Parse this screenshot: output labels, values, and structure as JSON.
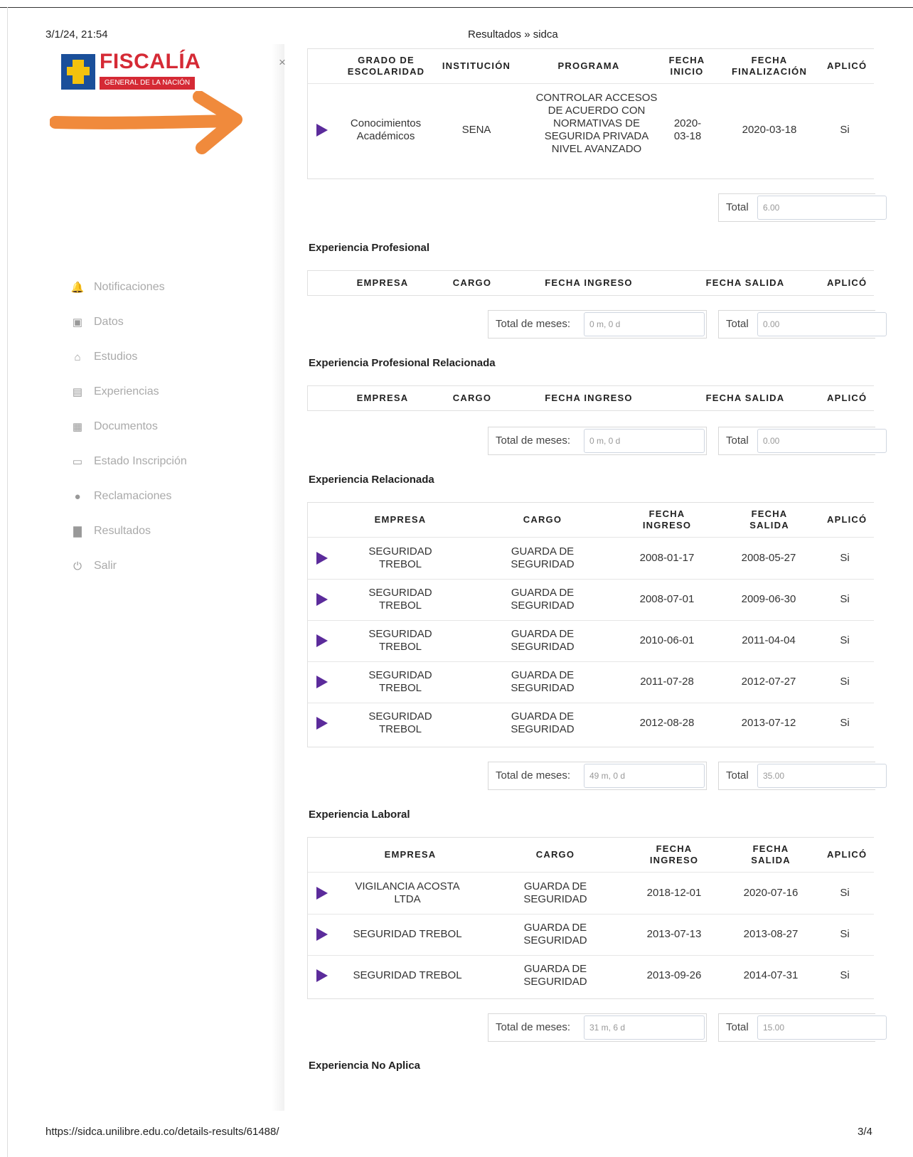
{
  "print": {
    "date": "3/1/24, 21:54",
    "title": "Resultados » sidca",
    "url": "https://sidca.unilibre.edu.co/details-results/61488/",
    "page": "3/4"
  },
  "logo": {
    "word": "FISCALÍA",
    "subtitle": "GENERAL DE LA NACIÓN"
  },
  "sidebar": {
    "close": "×",
    "items": [
      {
        "label": "Notificaciones",
        "icon": "bell-icon"
      },
      {
        "label": "Datos",
        "icon": "clipboard-icon"
      },
      {
        "label": "Estudios",
        "icon": "graduation-cap-icon"
      },
      {
        "label": "Experiencias",
        "icon": "briefcase-icon"
      },
      {
        "label": "Documentos",
        "icon": "id-card-icon"
      },
      {
        "label": "Estado Inscripción",
        "icon": "credit-card-icon"
      },
      {
        "label": "Reclamaciones",
        "icon": "comment-icon"
      },
      {
        "label": "Resultados",
        "icon": "bar-chart-icon"
      },
      {
        "label": "Salir",
        "icon": "power-icon"
      }
    ]
  },
  "education": {
    "headers": [
      "GRADO DE ESCOLARIDAD",
      "INSTITUCIÓN",
      "PROGRAMA",
      "FECHA INICIO",
      "FECHA FINALIZACIÓN",
      "APLICÓ"
    ],
    "rows": [
      {
        "grado": "Conocimientos Académicos",
        "institucion": "SENA",
        "programa": "CONTROLAR ACCESOS DE ACUERDO CON NORMATIVAS DE SEGURIDA PRIVADA NIVEL AVANZADO",
        "inicio": "2020-03-18",
        "fin": "2020-03-18",
        "aplico": "Si"
      }
    ],
    "total_label": "Total",
    "total_value": "6.00"
  },
  "exp_prof": {
    "title": "Experiencia Profesional",
    "headers": [
      "EMPRESA",
      "CARGO",
      "FECHA INGRESO",
      "FECHA SALIDA",
      "APLICÓ"
    ],
    "meses_label": "Total de meses:",
    "meses_value": "0 m, 0 d",
    "total_label": "Total",
    "total_value": "0.00"
  },
  "exp_prof_rel": {
    "title": "Experiencia Profesional Relacionada",
    "headers": [
      "EMPRESA",
      "CARGO",
      "FECHA INGRESO",
      "FECHA SALIDA",
      "APLICÓ"
    ],
    "meses_label": "Total de meses:",
    "meses_value": "0 m, 0 d",
    "total_label": "Total",
    "total_value": "0.00"
  },
  "exp_rel": {
    "title": "Experiencia Relacionada",
    "headers": [
      "EMPRESA",
      "CARGO",
      "FECHA INGRESO",
      "FECHA SALIDA",
      "APLICÓ"
    ],
    "rows": [
      {
        "empresa": "SEGURIDAD TREBOL",
        "cargo": "GUARDA DE SEGURIDAD",
        "ingreso": "2008-01-17",
        "salida": "2008-05-27",
        "aplico": "Si"
      },
      {
        "empresa": "SEGURIDAD TREBOL",
        "cargo": "GUARDA DE SEGURIDAD",
        "ingreso": "2008-07-01",
        "salida": "2009-06-30",
        "aplico": "Si"
      },
      {
        "empresa": "SEGURIDAD TREBOL",
        "cargo": "GUARDA DE SEGURIDAD",
        "ingreso": "2010-06-01",
        "salida": "2011-04-04",
        "aplico": "Si"
      },
      {
        "empresa": "SEGURIDAD TREBOL",
        "cargo": "GUARDA DE SEGURIDAD",
        "ingreso": "2011-07-28",
        "salida": "2012-07-27",
        "aplico": "Si"
      },
      {
        "empresa": "SEGURIDAD TREBOL",
        "cargo": "GUARDA DE SEGURIDAD",
        "ingreso": "2012-08-28",
        "salida": "2013-07-12",
        "aplico": "Si"
      }
    ],
    "meses_label": "Total de meses:",
    "meses_value": "49 m, 0 d",
    "total_label": "Total",
    "total_value": "35.00"
  },
  "exp_lab": {
    "title": "Experiencia Laboral",
    "headers": [
      "EMPRESA",
      "CARGO",
      "FECHA INGRESO",
      "FECHA SALIDA",
      "APLICÓ"
    ],
    "rows": [
      {
        "empresa": "VIGILANCIA ACOSTA LTDA",
        "cargo": "GUARDA DE SEGURIDAD",
        "ingreso": "2018-12-01",
        "salida": "2020-07-16",
        "aplico": "Si"
      },
      {
        "empresa": "SEGURIDAD TREBOL",
        "cargo": "GUARDA DE SEGURIDAD",
        "ingreso": "2013-07-13",
        "salida": "2013-08-27",
        "aplico": "Si"
      },
      {
        "empresa": "SEGURIDAD TREBOL",
        "cargo": "GUARDA DE SEGURIDAD",
        "ingreso": "2013-09-26",
        "salida": "2014-07-31",
        "aplico": "Si"
      }
    ],
    "meses_label": "Total de meses:",
    "meses_value": "31 m, 6 d",
    "total_label": "Total",
    "total_value": "15.00"
  },
  "exp_no_aplica": {
    "title": "Experiencia No Aplica"
  },
  "colors": {
    "accent": "#5b2b9b",
    "brand_red": "#d52a35",
    "brand_blue": "#1a4f9a",
    "arrow": "#f08a3c"
  }
}
